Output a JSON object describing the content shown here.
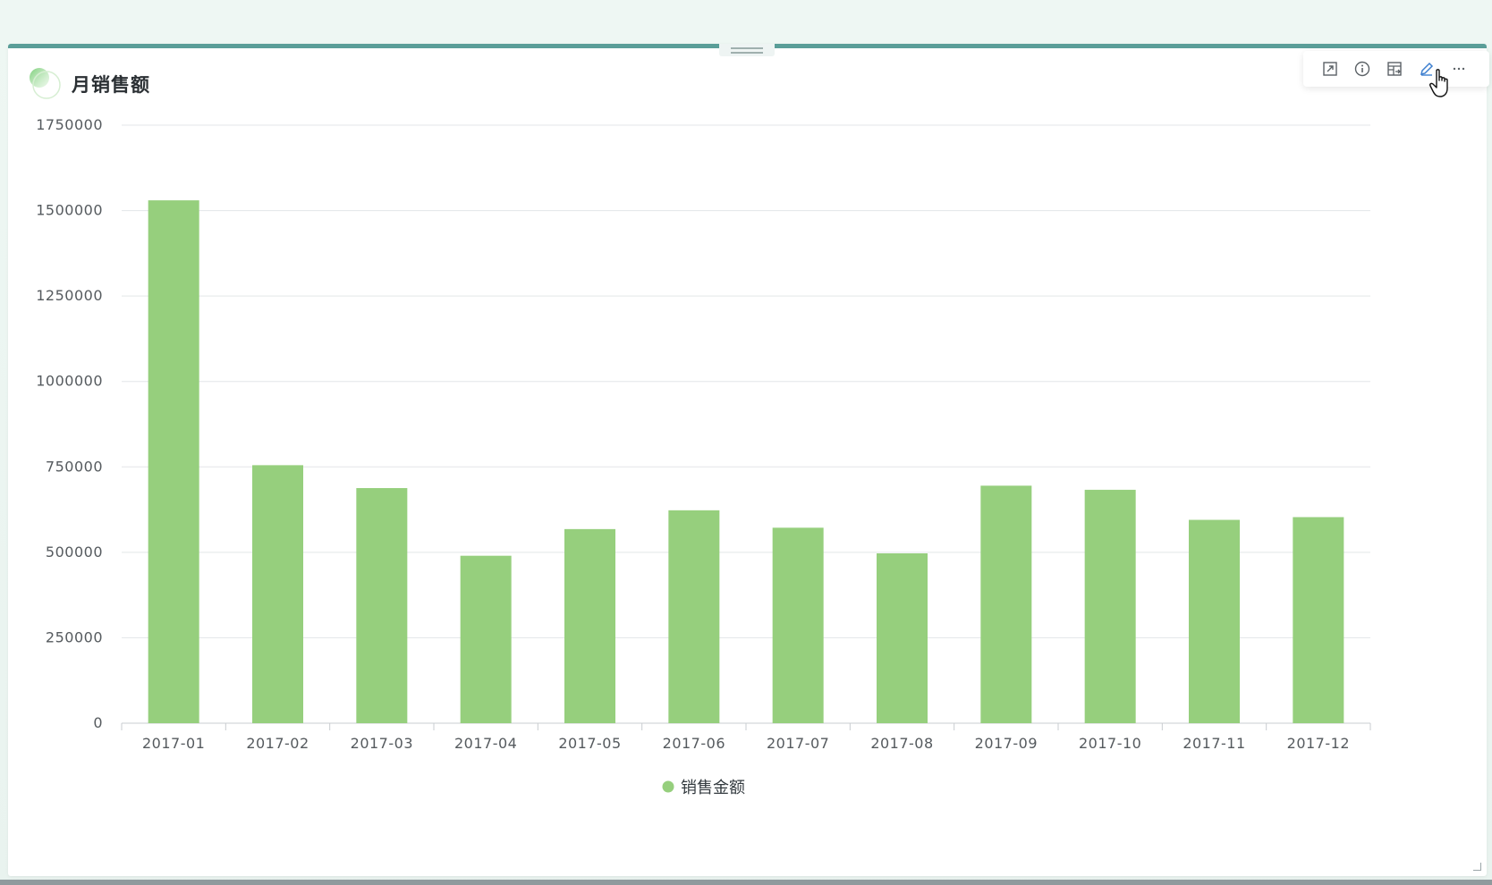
{
  "title": "月销售额",
  "toolbar": {
    "icons": [
      "expand-icon",
      "info-icon",
      "data-table-icon",
      "edit-pencil-icon",
      "more-icon"
    ]
  },
  "colors": {
    "bar": "#96cf7d",
    "accent_top": "#5a9e98",
    "axis_text": "#555a5e",
    "grid": "#e3e6e8"
  },
  "chart_data": {
    "type": "bar",
    "title": "",
    "xlabel": "",
    "ylabel": "",
    "categories": [
      "2017-01",
      "2017-02",
      "2017-03",
      "2017-04",
      "2017-05",
      "2017-06",
      "2017-07",
      "2017-08",
      "2017-09",
      "2017-10",
      "2017-11",
      "2017-12"
    ],
    "series": [
      {
        "name": "销售金额",
        "values": [
          1530000,
          755000,
          688000,
          490000,
          568000,
          623000,
          572000,
          497000,
          695000,
          683000,
          595000,
          603000
        ]
      }
    ],
    "ylim": [
      0,
      1750000
    ],
    "yticks": [
      "0",
      "250000",
      "500000",
      "750000",
      "1000000",
      "1250000",
      "1500000",
      "1750000"
    ],
    "grid": true,
    "legend": "bottom-center"
  }
}
